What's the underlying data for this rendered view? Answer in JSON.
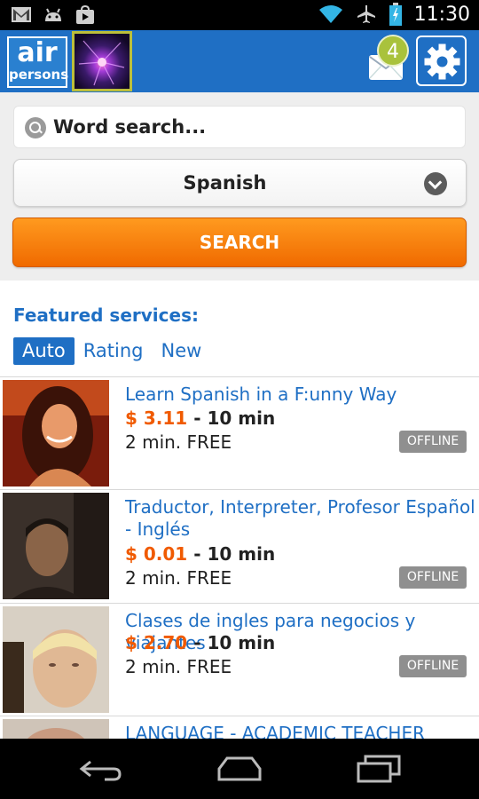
{
  "status_bar": {
    "time": "11:30",
    "icons": [
      "gmail-icon",
      "android-debug-icon",
      "play-store-icon",
      "wifi-icon",
      "airplane-icon",
      "battery-icon"
    ]
  },
  "app_bar": {
    "logo_line1": "air",
    "logo_line2": "persons",
    "notification_count": "4",
    "brand_color": "#1f6fc4"
  },
  "search": {
    "placeholder": "Word search...",
    "language": "Spanish",
    "button_label": "SEARCH",
    "button_color": "#f47a0c"
  },
  "featured": {
    "title": "Featured services:",
    "tabs": [
      {
        "label": "Auto",
        "active": true
      },
      {
        "label": "Rating",
        "active": false
      },
      {
        "label": "New",
        "active": false
      }
    ]
  },
  "services": [
    {
      "title": "Learn Spanish in a F:unny Way",
      "price": "$ 3.11",
      "duration": " - 10 min",
      "free": "2 min. FREE",
      "status": "OFFLINE"
    },
    {
      "title": "Traductor, Interpreter, Profesor Español - Inglés",
      "price": "$ 0.01",
      "duration": " - 10 min",
      "free": "2 min. FREE",
      "status": "OFFLINE"
    },
    {
      "title": "Clases de ingles para negocios y viajantes",
      "price": "$ 2.70",
      "duration": " - 10 min",
      "free": "2 min. FREE",
      "status": "OFFLINE"
    },
    {
      "title": "LANGUAGE - ACADEMIC TEACHER"
    }
  ]
}
